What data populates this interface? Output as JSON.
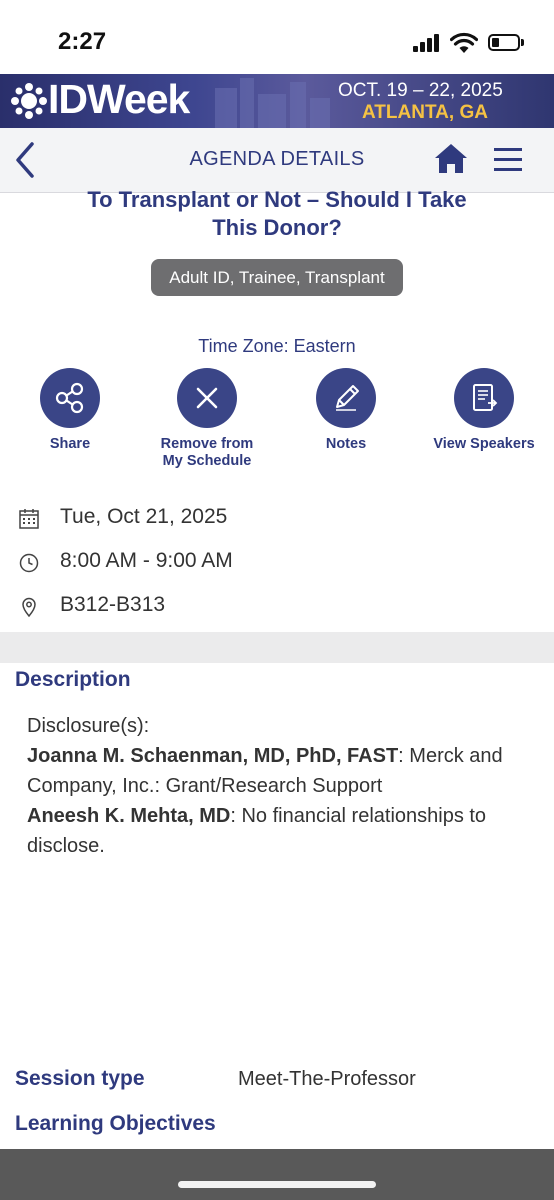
{
  "status_bar": {
    "time": "2:27"
  },
  "banner": {
    "logo": "IDWeek",
    "dates": "OCT. 19 – 22, 2025",
    "city": "ATLANTA, GA"
  },
  "nav": {
    "title": "AGENDA DETAILS",
    "icons": [
      "chevron-left-icon",
      "home-icon",
      "hamburger-menu-icon"
    ]
  },
  "session": {
    "title_line1": "To Transplant or Not – Should I Take",
    "title_line2": "This Donor?",
    "tags": "Adult ID, Trainee, Transplant",
    "timezone": "Time Zone: Eastern"
  },
  "actions": {
    "share": "Share",
    "remove_line1": "Remove from",
    "remove_line2": "My Schedule",
    "notes": "Notes",
    "speakers": "View Speakers"
  },
  "details": {
    "date": "Tue, Oct 21, 2025",
    "time": "8:00 AM - 9:00 AM",
    "room": "B312-B313"
  },
  "description": {
    "heading": "Description",
    "disclosure_label": "Disclosure(s):",
    "speaker1_name": "Joanna M. Schaenman, MD, PhD, FAST",
    "speaker1_text": ": Merck and Company, Inc.: Grant/Research Support",
    "speaker2_name": "Aneesh K. Mehta, MD",
    "speaker2_text": ": No financial relationships to disclose."
  },
  "session_type": {
    "label": "Session type",
    "value": "Meet-The-Professor"
  },
  "learning_objectives": {
    "heading": "Learning Objectives"
  },
  "colors": {
    "primary": "#2f3a7e",
    "button_fill": "#3a4587",
    "chip": "#6e6e70",
    "banner_accent": "#f5c243"
  }
}
